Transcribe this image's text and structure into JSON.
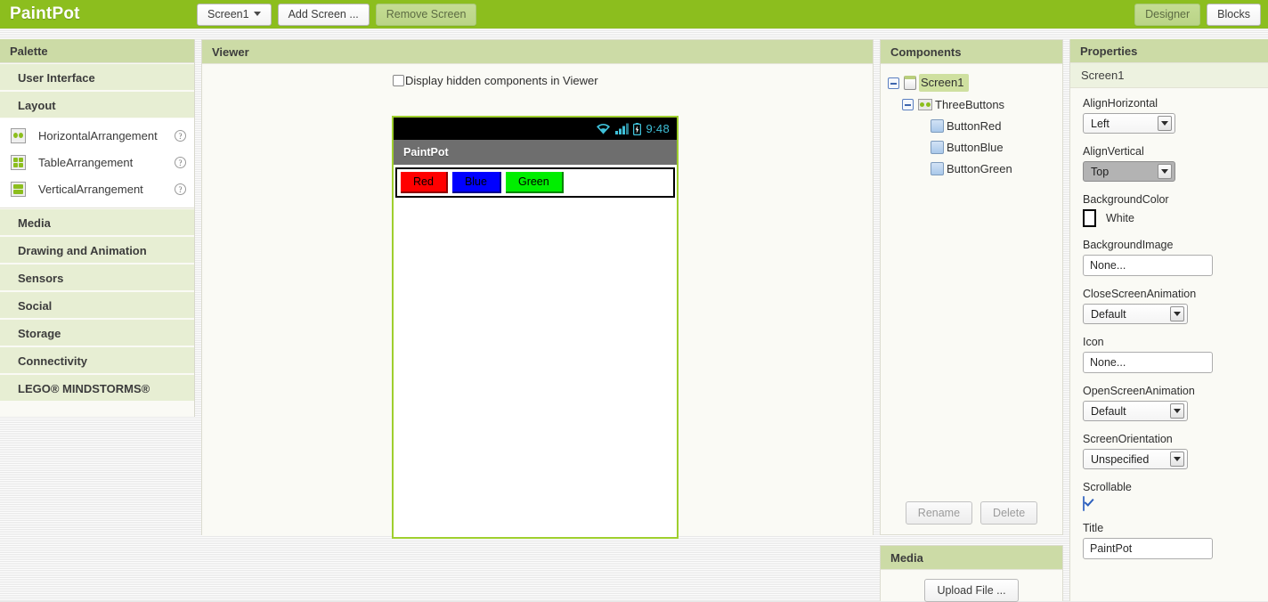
{
  "topbar": {
    "app_title": "PaintPot",
    "screen_selector": "Screen1",
    "add_screen_label": "Add Screen ...",
    "remove_screen_label": "Remove Screen",
    "designer_label": "Designer",
    "blocks_label": "Blocks"
  },
  "palette": {
    "header": "Palette",
    "categories": [
      {
        "label": "User Interface",
        "expanded": false
      },
      {
        "label": "Layout",
        "expanded": true
      },
      {
        "label": "Media",
        "expanded": false
      },
      {
        "label": "Drawing and Animation",
        "expanded": false
      },
      {
        "label": "Sensors",
        "expanded": false
      },
      {
        "label": "Social",
        "expanded": false
      },
      {
        "label": "Storage",
        "expanded": false
      },
      {
        "label": "Connectivity",
        "expanded": false
      },
      {
        "label": "LEGO® MINDSTORMS®",
        "expanded": false
      }
    ],
    "layout_items": [
      {
        "label": "HorizontalArrangement",
        "icon": "horizontal-arrangement-icon",
        "help": "?"
      },
      {
        "label": "TableArrangement",
        "icon": "table-arrangement-icon",
        "help": "?"
      },
      {
        "label": "VerticalArrangement",
        "icon": "vertical-arrangement-icon",
        "help": "?"
      }
    ]
  },
  "viewer": {
    "header": "Viewer",
    "hidden_components_label": "Display hidden components in Viewer",
    "hidden_components_checked": false,
    "phone": {
      "status_time": "9:48",
      "status_icons": [
        "wifi-icon",
        "signal-icon",
        "battery-icon"
      ],
      "title": "PaintPot",
      "buttons": [
        {
          "text": "Red",
          "color": "#FF0000"
        },
        {
          "text": "Blue",
          "color": "#0000FF"
        },
        {
          "text": "Green",
          "color": "#00EE00"
        }
      ]
    }
  },
  "components": {
    "header": "Components",
    "tree": [
      {
        "label": "Screen1",
        "icon": "screen-icon",
        "depth": 0,
        "selected": true,
        "expander": true
      },
      {
        "label": "ThreeButtons",
        "icon": "horizontal-arrangement-icon",
        "depth": 1,
        "selected": false,
        "expander": true
      },
      {
        "label": "ButtonRed",
        "icon": "button-icon",
        "depth": 2,
        "selected": false,
        "expander": false
      },
      {
        "label": "ButtonBlue",
        "icon": "button-icon",
        "depth": 2,
        "selected": false,
        "expander": false
      },
      {
        "label": "ButtonGreen",
        "icon": "button-icon",
        "depth": 2,
        "selected": false,
        "expander": false
      }
    ],
    "rename_label": "Rename",
    "delete_label": "Delete"
  },
  "media": {
    "header": "Media",
    "upload_label": "Upload File ..."
  },
  "properties": {
    "header": "Properties",
    "selected_component": "Screen1",
    "items": [
      {
        "label": "AlignHorizontal",
        "type": "select",
        "value": "Left",
        "highlight": false
      },
      {
        "label": "AlignVertical",
        "type": "select",
        "value": "Top",
        "highlight": true
      },
      {
        "label": "BackgroundColor",
        "type": "color",
        "value": "White",
        "swatch": "#FFFFFF"
      },
      {
        "label": "BackgroundImage",
        "type": "text",
        "value": "None..."
      },
      {
        "label": "CloseScreenAnimation",
        "type": "select",
        "value": "Default",
        "highlight": false
      },
      {
        "label": "Icon",
        "type": "text",
        "value": "None..."
      },
      {
        "label": "OpenScreenAnimation",
        "type": "select",
        "value": "Default",
        "highlight": false
      },
      {
        "label": "ScreenOrientation",
        "type": "select",
        "value": "Unspecified",
        "highlight": false
      },
      {
        "label": "Scrollable",
        "type": "checkbox",
        "checked": true
      },
      {
        "label": "Title",
        "type": "text",
        "value": "PaintPot"
      }
    ]
  },
  "colors": {
    "brand_green": "#8cbe1e",
    "panel_header": "#ccdba6",
    "category_bg": "#e7eed3",
    "selection": "#cfe0a0"
  }
}
